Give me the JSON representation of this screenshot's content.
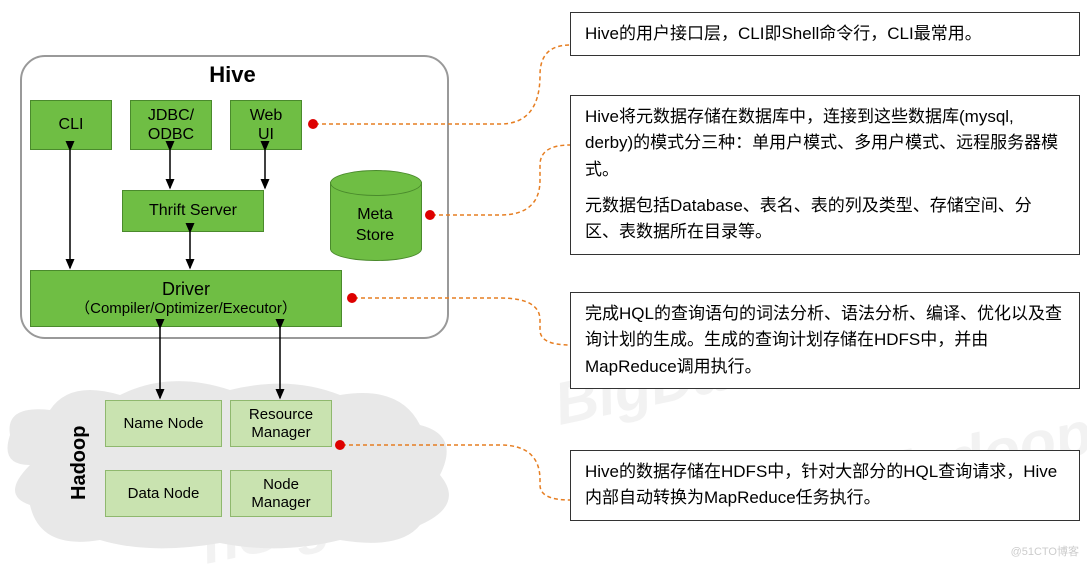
{
  "hive": {
    "title": "Hive",
    "cli": "CLI",
    "jdbc": "JDBC/\nODBC",
    "webui": "Web\nUI",
    "thrift": "Thrift Server",
    "driver_main": "Driver",
    "driver_sub": "（Compiler/Optimizer/Executor）",
    "metastore": "Meta\nStore"
  },
  "hadoop": {
    "label": "Hadoop",
    "namenode": "Name Node",
    "rm": "Resource\nManager",
    "datanode": "Data Node",
    "nm": "Node\nManager"
  },
  "descriptions": {
    "d1": "Hive的用户接口层，CLI即Shell命令行，CLI最常用。",
    "d2a": "Hive将元数据存储在数据库中，连接到这些数据库(mysql, derby)的模式分三种：单用户模式、多用户模式、远程服务器模式。",
    "d2b": "元数据包括Database、表名、表的列及类型、存储空间、分区、表数据所在目录等。",
    "d3": "完成HQL的查询语句的词法分析、语法分析、编译、优化以及查询计划的生成。生成的查询计划存储在HDFS中，并由MapReduce调用执行。",
    "d4": "Hive的数据存储在HDFS中，针对大部分的HQL查询请求，Hive内部自动转换为MapReduce任务执行。"
  },
  "watermark": {
    "wm1": "BigData Platform",
    "wm2": "Hadoop",
    "wm3": "nSight"
  },
  "blog": "@51CTO博客"
}
